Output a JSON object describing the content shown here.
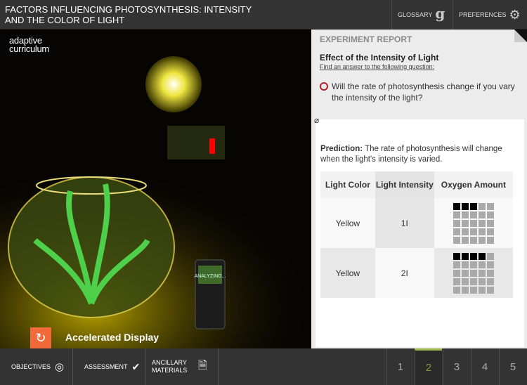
{
  "header": {
    "title": "FACTORS INFLUENCING PHOTOSYNTHESIS: INTENSITY AND THE COLOR OF LIGHT",
    "glossary": "GLOSSARY",
    "preferences": "PREFERENCES"
  },
  "scene": {
    "logo_line1": "adaptive",
    "logo_line2": "curriculum",
    "analyzer_text": "ANALYZING...",
    "caption": "Accelerated Display"
  },
  "report": {
    "heading": "EXPERIMENT REPORT",
    "subtitle": "Effect of the Intensity of Light",
    "instruction": "Find an answer to the following question:",
    "question": "Will the rate of photosynthesis change if you vary the intensity of the light?",
    "prediction_label": "Prediction:",
    "prediction_text": " The rate of photosynthesis will change when the light's intensity is varied.",
    "table": {
      "headers": [
        "Light Color",
        "Light Intensity",
        "Oxygen Amount"
      ],
      "rows": [
        {
          "color": "Yellow",
          "intensity": "1I",
          "oxygen_filled": 3,
          "oxygen_total": 25
        },
        {
          "color": "Yellow",
          "intensity": "2I",
          "oxygen_filled": 4,
          "oxygen_total": 25
        }
      ]
    }
  },
  "footer": {
    "objectives": "OBJECTIVES",
    "assessment": "ASSESSMENT",
    "ancillary": "ANCILLARY MATERIALS",
    "pages": [
      "1",
      "2",
      "3",
      "4",
      "5"
    ],
    "active_page": "2"
  },
  "colors": {
    "accent_orange": "#f26a3a",
    "active_page": "#7f9a3a",
    "radio_ring": "#b3212a"
  }
}
